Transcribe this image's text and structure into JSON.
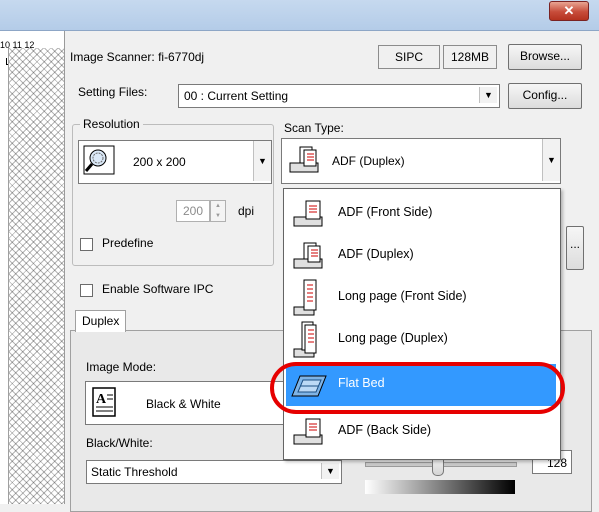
{
  "window": {
    "close_label": "✕"
  },
  "ruler": {
    "numbers": "10  11  12"
  },
  "header": {
    "scanner_label": "Image Scanner:",
    "scanner_value": "fi-6770dj",
    "sipc_label": "SIPC",
    "memory_label": "128MB",
    "browse_label": "Browse...",
    "setting_files_label": "Setting Files:",
    "setting_files_value": "00 : Current Setting",
    "config_label": "Config..."
  },
  "resolution": {
    "legend": "Resolution",
    "value": "200 x 200",
    "custom_value": "200",
    "unit": "dpi",
    "predefine_label": "Predefine"
  },
  "scan_type": {
    "legend": "Scan Type:",
    "selected": "ADF (Duplex)",
    "options": [
      "ADF (Front Side)",
      "ADF (Duplex)",
      "Long page (Front Side)",
      "Long page (Duplex)",
      "Flat Bed",
      "ADF (Back Side)"
    ],
    "highlighted_option": "Flat Bed",
    "highlight_color": "#3399ff",
    "annotation_color": "#e60000"
  },
  "ipc": {
    "enable_label": "Enable Software IPC"
  },
  "tabs": {
    "duplex_label": "Duplex"
  },
  "image_mode": {
    "label": "Image Mode:",
    "value": "Black & White"
  },
  "bw": {
    "label": "Black/White:",
    "value": "Static Threshold",
    "threshold_value": "128"
  },
  "more_button_label": "..."
}
